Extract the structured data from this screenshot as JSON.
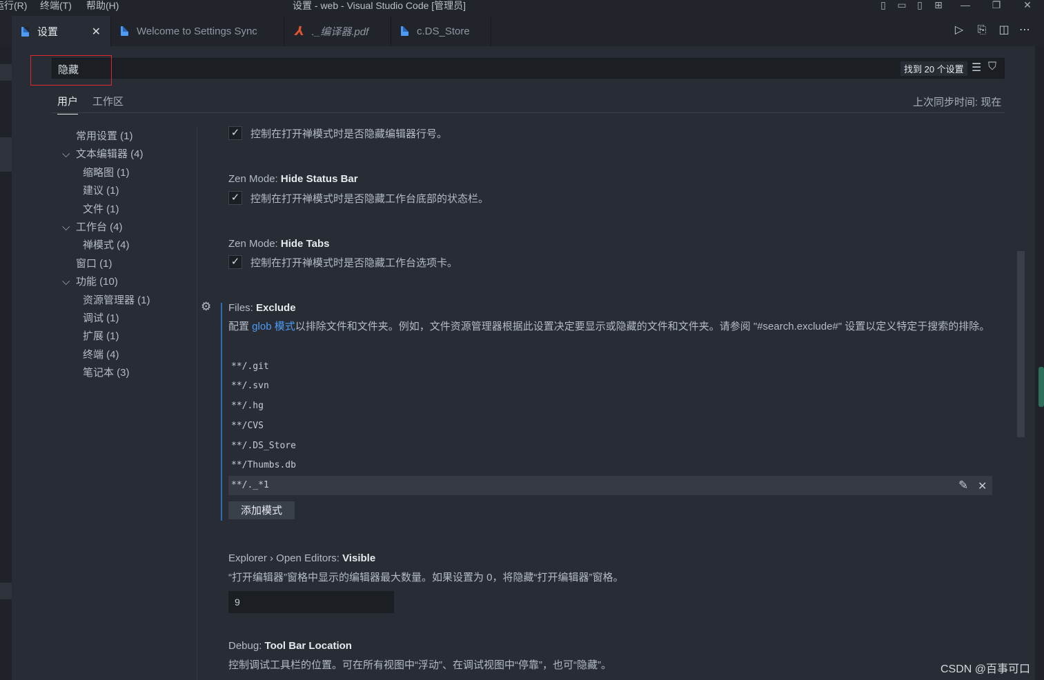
{
  "titlebar": {
    "menu_run": "运行(R)",
    "menu_terminal": "终端(T)",
    "menu_help": "帮助(H)",
    "title": "设置 - web - Visual Studio Code [管理员]"
  },
  "tabs": [
    {
      "label": "设置",
      "icon": "file-icon"
    },
    {
      "label": "Welcome to Settings Sync",
      "icon": "file-icon"
    },
    {
      "label": "._编译器.pdf",
      "icon": "pdf-icon"
    },
    {
      "label": "c.DS_Store",
      "icon": "file-icon"
    }
  ],
  "search": {
    "value": "隐藏",
    "result_count": "找到 20 个设置"
  },
  "scopes": {
    "user": "用户",
    "workspace": "工作区"
  },
  "sync_status": "上次同步时间: 现在",
  "toc": [
    {
      "label": "常用设置 (1)",
      "level": 1,
      "expanded": false
    },
    {
      "label": "文本编辑器 (4)",
      "level": 1,
      "expanded": true
    },
    {
      "label": "缩略图 (1)",
      "level": 2
    },
    {
      "label": "建议 (1)",
      "level": 2
    },
    {
      "label": "文件 (1)",
      "level": 2
    },
    {
      "label": "工作台 (4)",
      "level": 1,
      "expanded": true
    },
    {
      "label": "禅模式 (4)",
      "level": 2
    },
    {
      "label": "窗口 (1)",
      "level": 1,
      "expanded": false
    },
    {
      "label": "功能 (10)",
      "level": 1,
      "expanded": true
    },
    {
      "label": "资源管理器 (1)",
      "level": 2
    },
    {
      "label": "调试 (1)",
      "level": 2
    },
    {
      "label": "扩展 (1)",
      "level": 2
    },
    {
      "label": "终端 (4)",
      "level": 2
    },
    {
      "label": "笔记本 (3)",
      "level": 2
    }
  ],
  "settings": {
    "hide_line_numbers": {
      "checked": true,
      "desc": "控制在打开禅模式时是否隐藏编辑器行号。"
    },
    "hide_status_bar": {
      "category": "Zen Mode:",
      "name": "Hide Status Bar",
      "checked": true,
      "desc": "控制在打开禅模式时是否隐藏工作台底部的状态栏。"
    },
    "hide_tabs": {
      "category": "Zen Mode:",
      "name": "Hide Tabs",
      "checked": true,
      "desc": "控制在打开禅模式时是否隐藏工作台选项卡。"
    },
    "files_exclude": {
      "category": "Files:",
      "name": "Exclude",
      "desc_prefix": "配置 ",
      "desc_link": "glob 模式",
      "desc_suffix": "以排除文件和文件夹。例如，文件资源管理器根据此设置决定要显示或隐藏的文件和文件夹。请参阅 \"#search.exclude#\" 设置以定义特定于搜索的排除。",
      "patterns": [
        "**/.git",
        "**/.svn",
        "**/.hg",
        "**/CVS",
        "**/.DS_Store",
        "**/Thumbs.db",
        "**/._*1"
      ],
      "add_button": "添加模式"
    },
    "open_editors": {
      "category": "Explorer › Open Editors:",
      "name": "Visible",
      "desc": "“打开编辑器”窗格中显示的编辑器最大数量。如果设置为 0，将隐藏“打开编辑器”窗格。",
      "value": "9"
    },
    "toolbar_location": {
      "category": "Debug:",
      "name": "Tool Bar Location",
      "desc": "控制调试工具栏的位置。可在所有视图中“浮动”、在调试视图中“停靠”，也可“隐藏”。"
    }
  },
  "watermark": "CSDN @百事可口",
  "colors": {
    "accent": "#4e9bf5",
    "highlight_box": "#e0282d",
    "background": "#282c34"
  }
}
